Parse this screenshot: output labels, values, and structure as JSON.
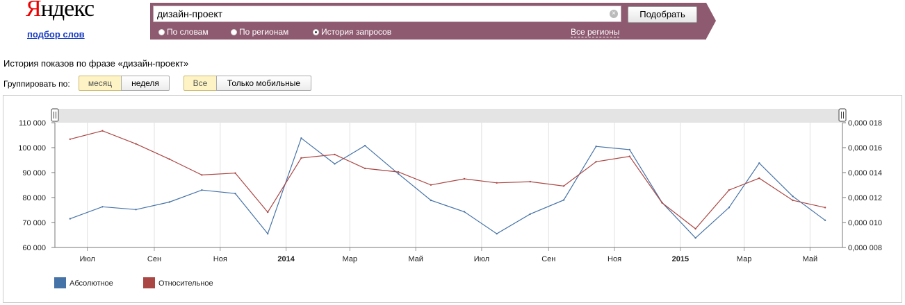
{
  "header": {
    "logo_first": "Я",
    "logo_rest": "ндекс",
    "sublink": "подбор слов"
  },
  "search": {
    "query": "дизайн-проект",
    "submit_label": "Подобрать",
    "clear_glyph": "⊗",
    "modes": [
      {
        "label": "По словам",
        "selected": false
      },
      {
        "label": "По регионам",
        "selected": false
      },
      {
        "label": "История запросов",
        "selected": true
      }
    ],
    "regions_link": "Все регионы"
  },
  "history": {
    "title": "История показов по фразе «дизайн-проект»",
    "group_label": "Группировать по:",
    "group_options": [
      {
        "label": "месяц",
        "active": true
      },
      {
        "label": "неделя",
        "active": false
      }
    ],
    "device_options": [
      {
        "label": "Все",
        "active": true
      },
      {
        "label": "Только мобильные",
        "active": false
      }
    ]
  },
  "colors": {
    "absolute": "#4572a7",
    "relative": "#aa4643",
    "brand_bar": "#8e5a70"
  },
  "chart_data": {
    "type": "line",
    "x": [
      "2013-06-15",
      "2013-07-15",
      "2013-08-15",
      "2013-09-15",
      "2013-10-15",
      "2013-11-15",
      "2013-12-15",
      "2014-01-15",
      "2014-02-15",
      "2014-03-15",
      "2014-04-15",
      "2014-05-15",
      "2014-06-15",
      "2014-07-15",
      "2014-08-15",
      "2014-09-15",
      "2014-10-15",
      "2014-11-15",
      "2014-12-15",
      "2015-01-15",
      "2015-02-15",
      "2015-03-15",
      "2015-04-15",
      "2015-05-15"
    ],
    "x_ticks": [
      {
        "label": "Июл",
        "date": "2013-07-01",
        "bold": false
      },
      {
        "label": "Сен",
        "date": "2013-09-01",
        "bold": false
      },
      {
        "label": "Ноя",
        "date": "2013-11-01",
        "bold": false
      },
      {
        "label": "2014",
        "date": "2014-01-01",
        "bold": true
      },
      {
        "label": "Мар",
        "date": "2014-03-01",
        "bold": false
      },
      {
        "label": "Май",
        "date": "2014-05-01",
        "bold": false
      },
      {
        "label": "Июл",
        "date": "2014-07-01",
        "bold": false
      },
      {
        "label": "Сен",
        "date": "2014-09-01",
        "bold": false
      },
      {
        "label": "Ноя",
        "date": "2014-11-01",
        "bold": false
      },
      {
        "label": "2015",
        "date": "2015-01-01",
        "bold": true
      },
      {
        "label": "Мар",
        "date": "2015-03-01",
        "bold": false
      },
      {
        "label": "Май",
        "date": "2015-05-01",
        "bold": false
      }
    ],
    "series": [
      {
        "name": "Абсолютное",
        "axis": "left",
        "color": "#4572a7",
        "values": [
          71500,
          76300,
          75200,
          78200,
          83000,
          81600,
          65500,
          103800,
          93500,
          100800,
          89500,
          78900,
          74300,
          65500,
          73400,
          79000,
          100500,
          99200,
          78000,
          63800,
          76000,
          93800,
          80500,
          70900
        ]
      },
      {
        "name": "Относительное",
        "axis": "right",
        "color": "#aa4643",
        "values": [
          0.01668,
          0.01735,
          0.0163,
          0.01508,
          0.01381,
          0.01396,
          0.01083,
          0.01517,
          0.01545,
          0.01434,
          0.01405,
          0.01301,
          0.0135,
          0.01318,
          0.01327,
          0.01292,
          0.01487,
          0.0153,
          0.01158,
          0.0095,
          0.0126,
          0.01355,
          0.01178,
          0.0112
        ]
      }
    ],
    "y_left": {
      "min": 60000,
      "max": 110000,
      "ticks": [
        {
          "value": 60000,
          "label": "60 000"
        },
        {
          "value": 70000,
          "label": "70 000"
        },
        {
          "value": 80000,
          "label": "80 000"
        },
        {
          "value": 90000,
          "label": "90 000"
        },
        {
          "value": 100000,
          "label": "100 000"
        },
        {
          "value": 110000,
          "label": "110 000"
        }
      ]
    },
    "y_right": {
      "min": 0.008,
      "max": 0.018,
      "ticks": [
        {
          "value": 0.008,
          "label": "0,000 008"
        },
        {
          "value": 0.01,
          "label": "0,000 010"
        },
        {
          "value": 0.012,
          "label": "0,000 012"
        },
        {
          "value": 0.014,
          "label": "0,000 014"
        },
        {
          "value": 0.016,
          "label": "0,000 016"
        },
        {
          "value": 0.018,
          "label": "0,000 018"
        }
      ]
    },
    "grid": "vertical",
    "legend_position": "bottom-left"
  }
}
